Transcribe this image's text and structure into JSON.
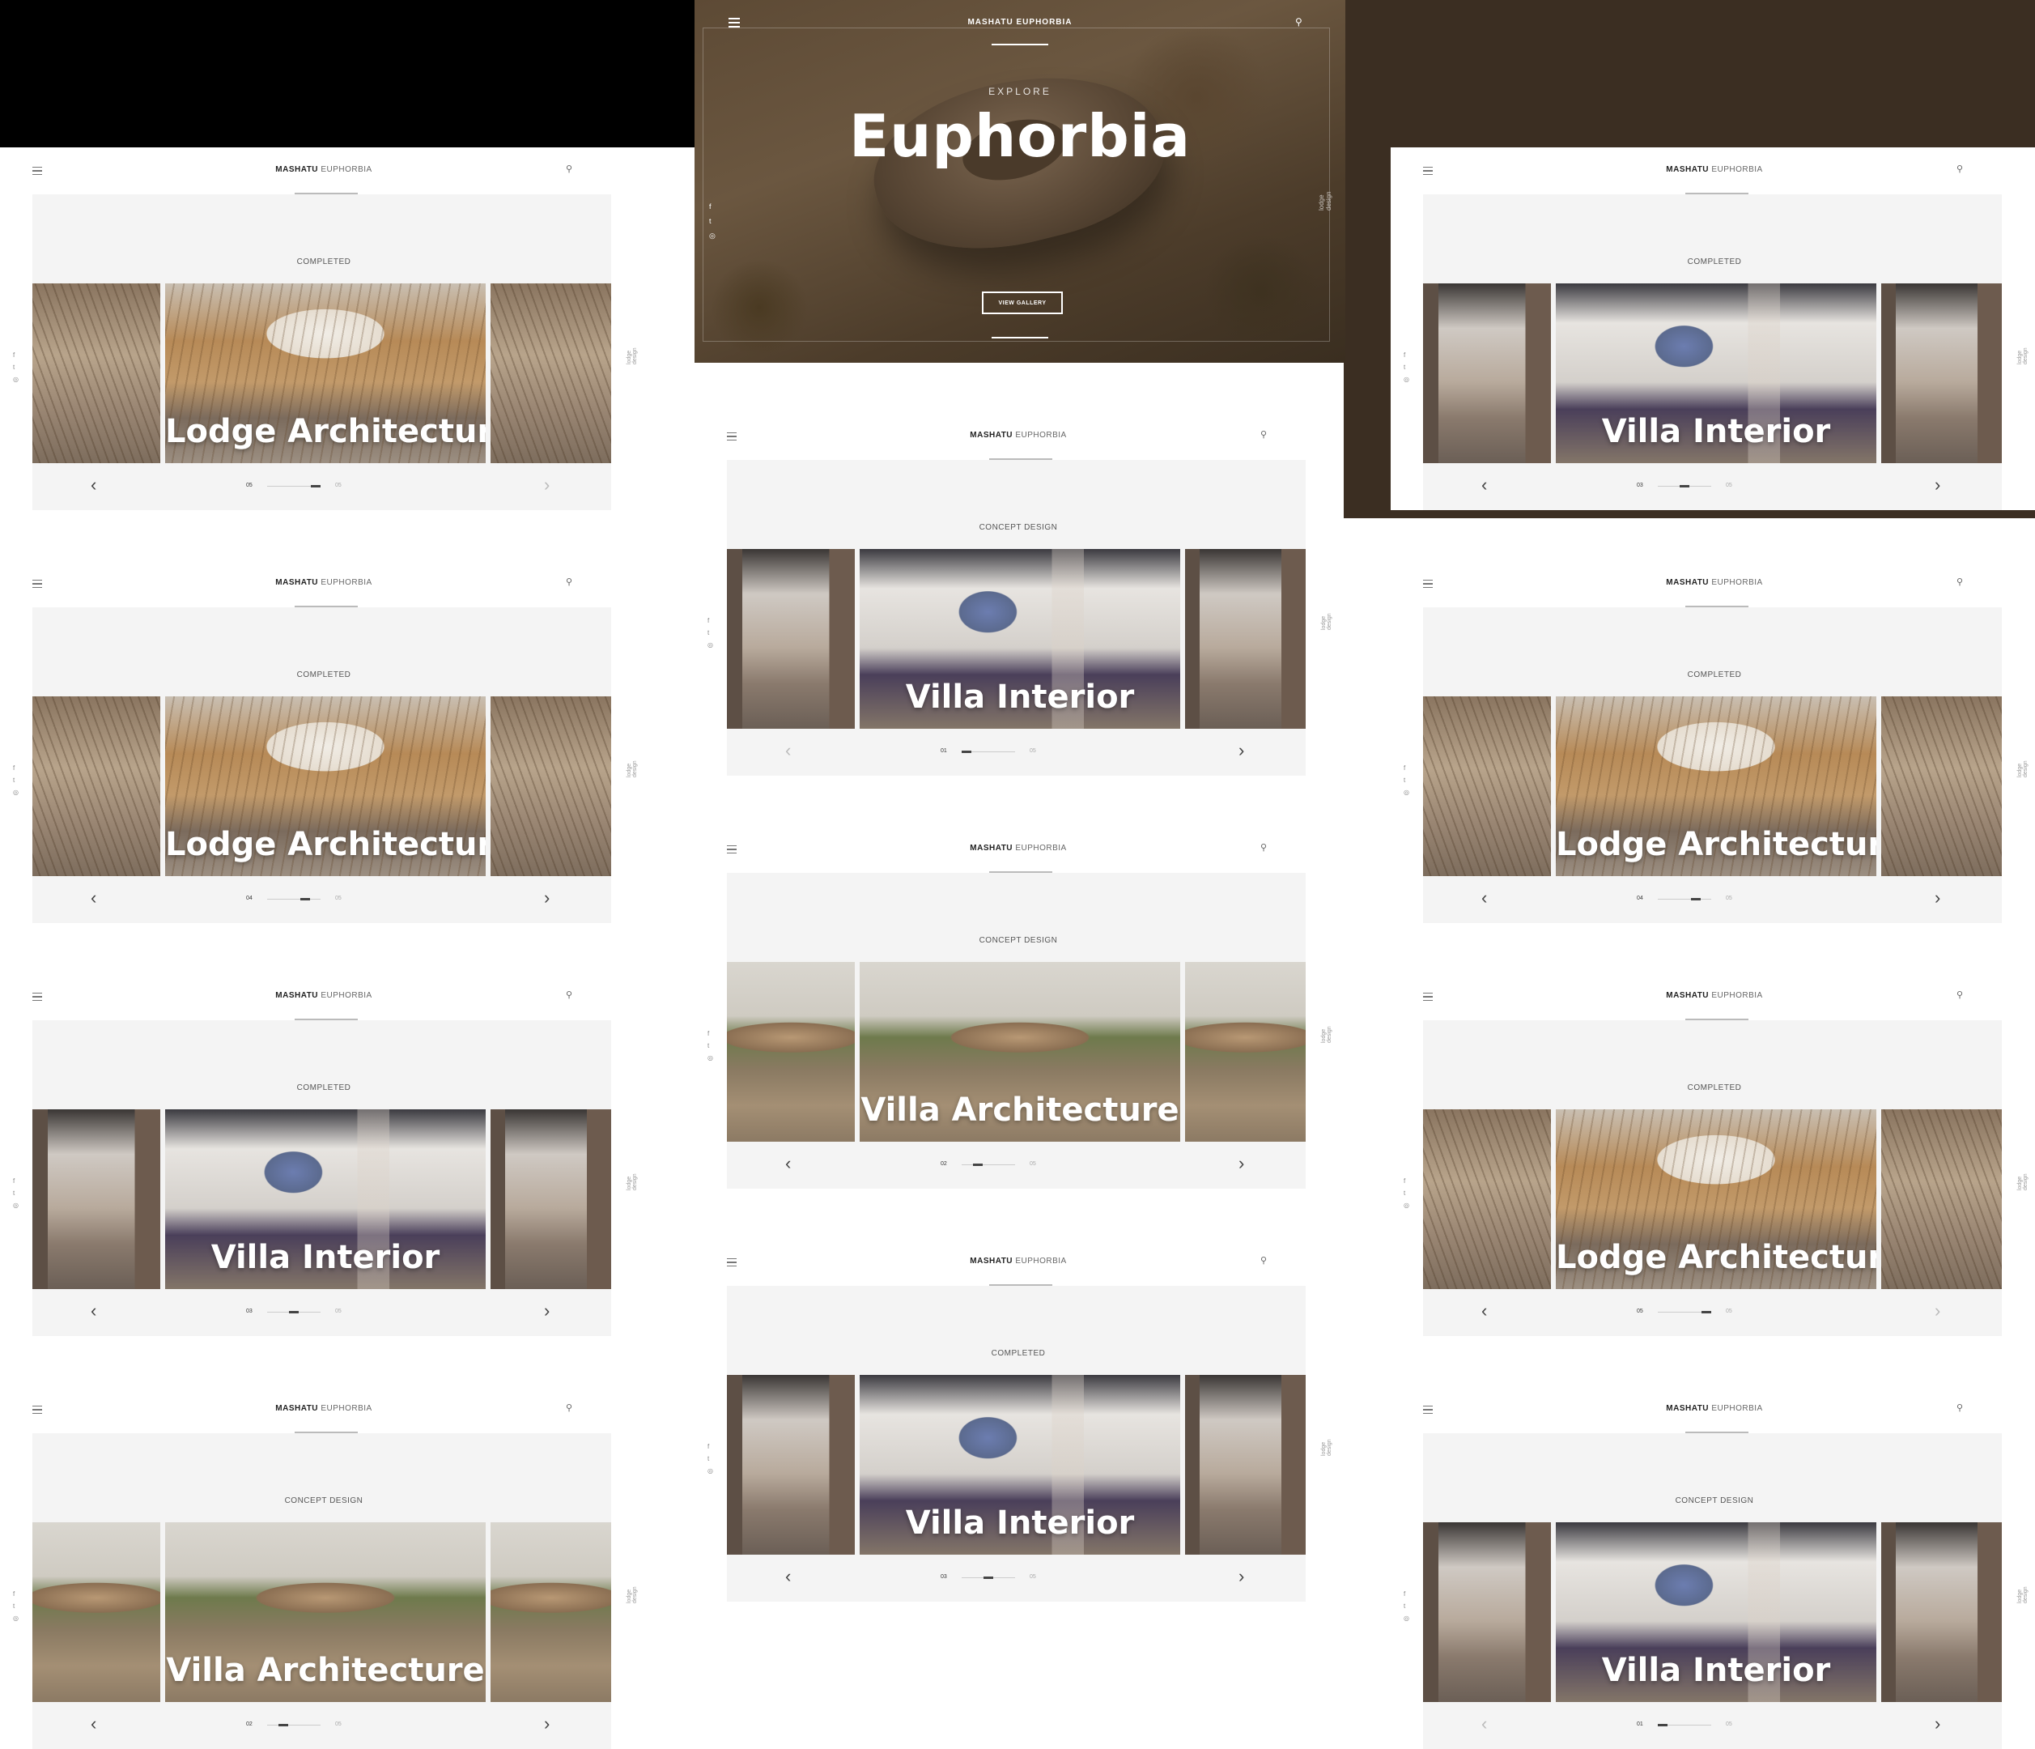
{
  "brand": {
    "bold": "MASHATU",
    "light": "EUPHORBIA"
  },
  "side_label": "lodge design",
  "hero": {
    "eyebrow": "EXPLORE",
    "title": "Euphorbia",
    "button": "VIEW GALLERY",
    "social": [
      "f",
      "t",
      "◎"
    ]
  },
  "screens": [
    {
      "status": "COMPLETED",
      "title": "Lodge Architecture",
      "current": "05",
      "total": "05",
      "progress": 1.0
    },
    {
      "status": "COMPLETED",
      "title": "Villa Interior",
      "current": "03",
      "total": "05",
      "progress": 0.6
    },
    {
      "status": "CONCEPT DESIGN",
      "title": "Villa Interior",
      "current": "01",
      "total": "05",
      "progress": 0.2
    },
    {
      "status": "COMPLETED",
      "title": "Lodge Architecture",
      "current": "04",
      "total": "05",
      "progress": 0.8
    },
    {
      "status": "COMPLETED",
      "title": "Lodge Architecture",
      "current": "04",
      "total": "05",
      "progress": 0.8
    },
    {
      "status": "CONCEPT DESIGN",
      "title": "Villa Architecture",
      "current": "02",
      "total": "05",
      "progress": 0.4
    },
    {
      "status": "COMPLETED",
      "title": "Villa Interior",
      "current": "03",
      "total": "05",
      "progress": 0.6
    },
    {
      "status": "COMPLETED",
      "title": "Lodge Architecture",
      "current": "05",
      "total": "05",
      "progress": 1.0
    },
    {
      "status": "COMPLETED",
      "title": "Villa Interior",
      "current": "03",
      "total": "05",
      "progress": 0.6
    },
    {
      "status": "CONCEPT DESIGN",
      "title": "Villa Architecture",
      "current": "02",
      "total": "05",
      "progress": 0.4
    },
    {
      "status": "CONCEPT DESIGN",
      "title": "Villa Interior",
      "current": "01",
      "total": "05",
      "progress": 0.2
    }
  ],
  "icons": {
    "menu": "hamburger-icon",
    "search": "search-icon",
    "prev": "chevron-left-icon",
    "next": "chevron-right-icon"
  },
  "glyphs": {
    "search": "⚲",
    "prev": "‹",
    "next": "›"
  }
}
